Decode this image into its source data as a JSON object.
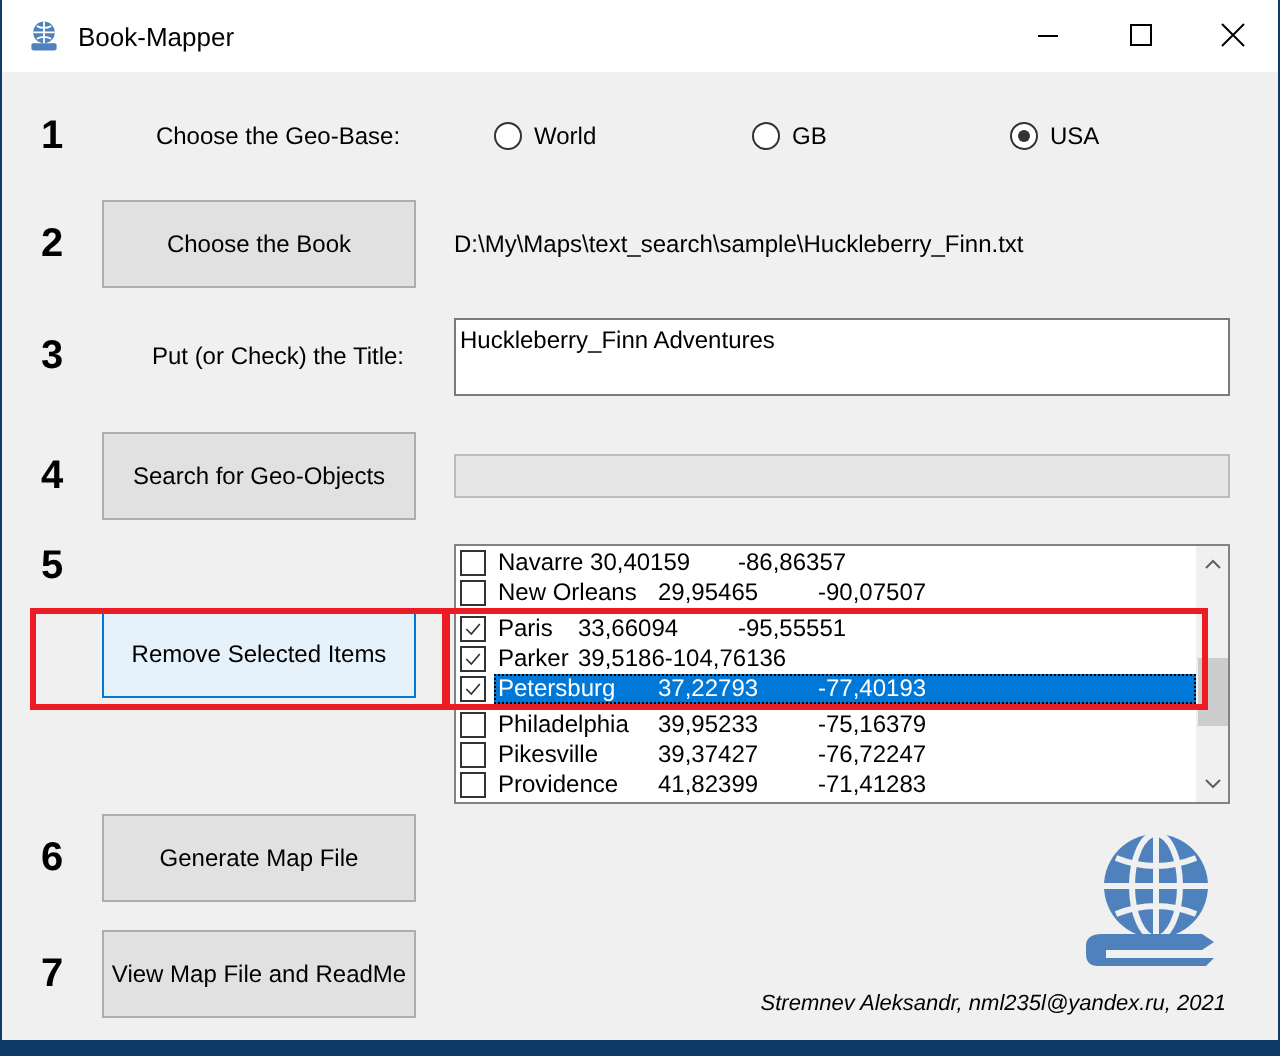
{
  "window": {
    "title": "Book-Mapper"
  },
  "steps": [
    {
      "number": "1",
      "kind": "radios",
      "label": "Choose the Geo-Base:",
      "options": [
        {
          "label": "World",
          "selected": false
        },
        {
          "label": "GB",
          "selected": false
        },
        {
          "label": "USA",
          "selected": true
        }
      ]
    },
    {
      "number": "2",
      "kind": "button-path",
      "button": "Choose the Book",
      "path": "D:\\My\\Maps\\text_search\\sample\\Huckleberry_Finn.txt"
    },
    {
      "number": "3",
      "kind": "label-field",
      "label": "Put (or Check) the Title:",
      "value": "Huckleberry_Finn Adventures"
    },
    {
      "number": "4",
      "kind": "button-progress",
      "button": "Search for Geo-Objects",
      "level": 0
    },
    {
      "number": "5",
      "kind": "button-list",
      "button": "Remove Selected Items",
      "focused": true,
      "items": [
        {
          "text": "Navarre 30,40159\t-86,86357",
          "checked": false,
          "selected": false
        },
        {
          "text": "New Orleans\t29,95465\t-90,07507",
          "checked": false,
          "selected": false
        },
        {
          "text": "Paris\t33,66094\t-95,55551",
          "checked": true,
          "selected": false
        },
        {
          "text": "Parker\t39,5186-104,76136",
          "checked": true,
          "selected": false
        },
        {
          "text": "Petersburg\t37,22793\t-77,40193",
          "checked": true,
          "selected": true
        },
        {
          "text": "Philadelphia\t39,95233\t-75,16379",
          "checked": false,
          "selected": false
        },
        {
          "text": "Pikesville\t39,37427\t-76,72247",
          "checked": false,
          "selected": false
        },
        {
          "text": "Providence\t41,82399\t-71,41283",
          "checked": false,
          "selected": false
        }
      ]
    },
    {
      "number": "6",
      "kind": "button",
      "button": "Generate Map File"
    },
    {
      "number": "7",
      "kind": "button",
      "button": "View Map File and ReadMe"
    }
  ],
  "author": "Stremnev Aleksandr, nml235l@yandex.ru, 2021"
}
